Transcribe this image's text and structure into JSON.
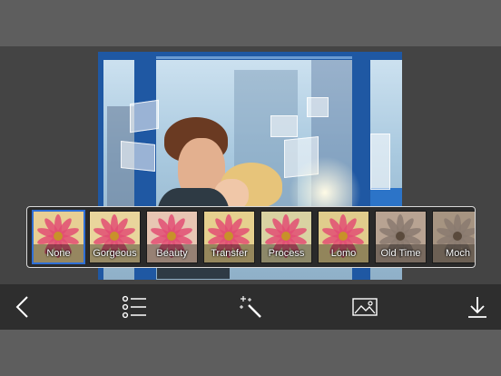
{
  "filters": {
    "items": [
      {
        "label": "None",
        "selected": true,
        "tint": "#e7cf94"
      },
      {
        "label": "Gorgeous",
        "selected": false,
        "tint": "#e9d59c"
      },
      {
        "label": "Beauty",
        "selected": false,
        "tint": "#e8c6b3"
      },
      {
        "label": "Transfer",
        "selected": false,
        "tint": "#e6d08e"
      },
      {
        "label": "Process",
        "selected": false,
        "tint": "#d9d2a2"
      },
      {
        "label": "Lomo",
        "selected": false,
        "tint": "#e0cc8c"
      },
      {
        "label": "Old Time",
        "selected": false,
        "tint": "#b8a392"
      },
      {
        "label": "Moch",
        "selected": false,
        "tint": "#a69481"
      }
    ]
  },
  "toolbar": {
    "icons": [
      "back-icon",
      "list-icon",
      "magic-wand-icon",
      "image-icon",
      "download-icon"
    ]
  },
  "colors": {
    "selection": "#2f6fd6",
    "toolbar_bg": "#2e2e2e",
    "chrome_bg": "#5e5e5e"
  }
}
